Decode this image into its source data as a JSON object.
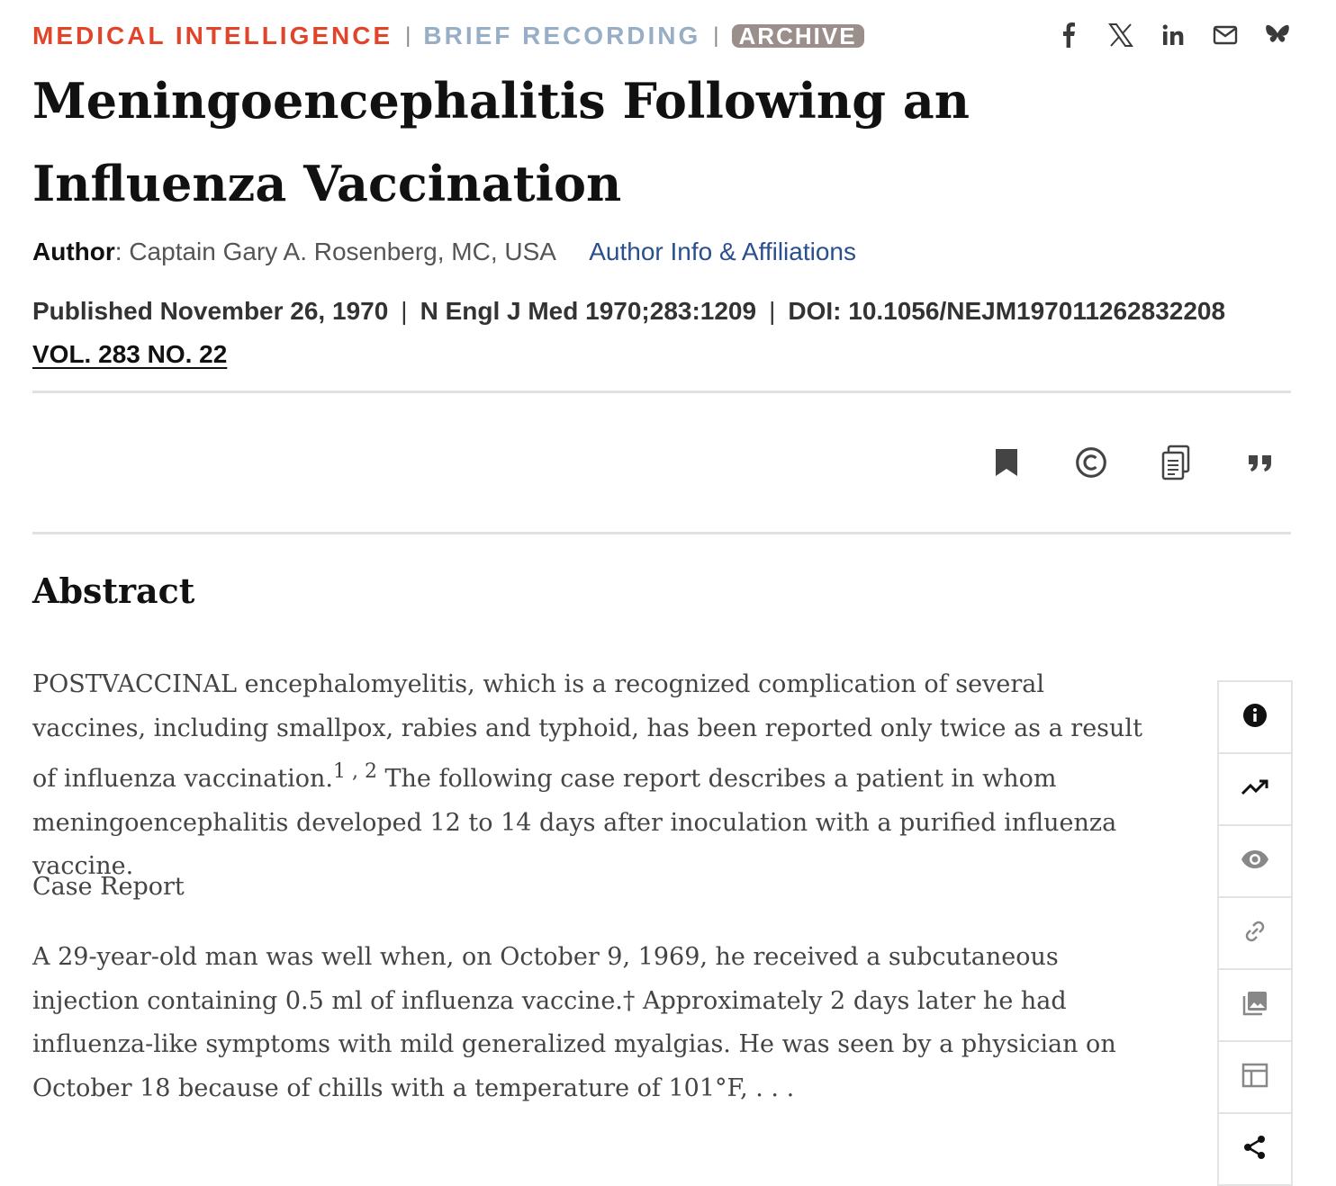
{
  "header": {
    "section": "MEDICAL INTELLIGENCE",
    "subsection": "BRIEF RECORDING",
    "badge": "ARCHIVE",
    "separator": "|",
    "social_icons": [
      "facebook-icon",
      "x-icon",
      "linkedin-icon",
      "email-icon",
      "bluesky-icon"
    ]
  },
  "article": {
    "title": "Meningoencephalitis Following an Influenza Vaccination",
    "author_label": "Author",
    "author_colon": ":",
    "author_name": "Captain Gary A. Rosenberg, MC, USA",
    "author_info_link": "Author Info & Affiliations",
    "published": "Published November 26, 1970",
    "citation": "N Engl J Med 1970;283:1209",
    "doi": "DOI: 10.1056/NEJM197011262832208",
    "volume": "VOL. 283 NO. 22"
  },
  "tools": [
    "bookmark-icon",
    "copyright-icon",
    "copy-icon",
    "quote-icon"
  ],
  "abstract": {
    "heading": "Abstract",
    "p1_a": "POSTVACCINAL encephalomyelitis, which is a recognized complication of several vaccines, including smallpox, rabies and typhoid, has been reported only twice as a result of influenza vaccination.",
    "p1_sup": "1 , 2",
    "p1_b": " The following case report describes a patient in whom meningoencephalitis developed 12 to 14 days after inoculation with a purified influenza vaccine.",
    "case_heading": "Case Report",
    "p2": "A 29-year-old man was well when, on October 9, 1969, he received a subcutaneous injection containing 0.5 ml of influenza vaccine.† Approximately 2 days later he had influenza-like symptoms with mild generalized myalgias. He was seen by a physician on October 18 because of chills with a temperature of 101°F, . . ."
  },
  "sidebar": [
    "info-icon",
    "metrics-icon",
    "view-icon",
    "link-icon",
    "figures-icon",
    "tables-icon",
    "share-icon"
  ]
}
